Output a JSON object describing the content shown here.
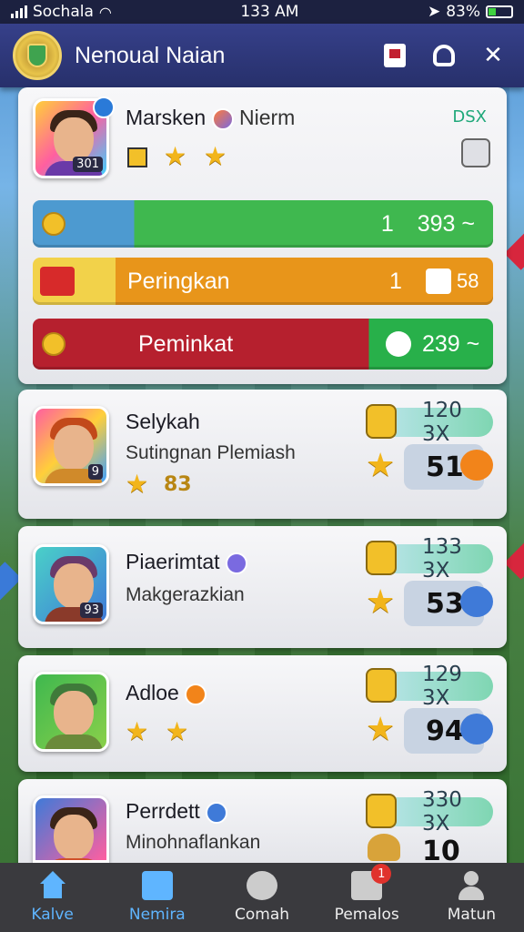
{
  "status_bar": {
    "carrier": "Sochala",
    "time": "133 AM",
    "battery": "83%"
  },
  "header": {
    "title": "Nenoual Naian"
  },
  "top_card": {
    "player_name": "Marsken",
    "player_suffix": "Nierm",
    "avatar_tag": "301",
    "right_label": "DSX",
    "bar_green_value": "393 ~",
    "bar_green_prefix": "1",
    "bar_orange_label": "Peringkan",
    "bar_orange_value": "1",
    "bar_orange_right": "58",
    "bar_red_label": "Peminkat",
    "bar_red_value": "239 ~"
  },
  "players": [
    {
      "name": "Selykah",
      "subtitle": "Sutingnan Plemiash",
      "avatar_tag": "9",
      "extra": "83",
      "pill": "120 3X",
      "score": "51"
    },
    {
      "name": "Piaerimtat",
      "subtitle": "Makgerazkian",
      "avatar_tag": "93",
      "extra": "",
      "pill": "133 3X",
      "score": "53"
    },
    {
      "name": "Adloe",
      "subtitle": "",
      "avatar_tag": "",
      "extra": "",
      "pill": "129 3X",
      "score": "94"
    },
    {
      "name": "Perrdett",
      "subtitle": "Minohnaflankan",
      "avatar_tag": "",
      "extra": "",
      "pill": "330 3X",
      "score": "10"
    }
  ],
  "nav": {
    "items": [
      {
        "label": "Kalve"
      },
      {
        "label": "Nemira"
      },
      {
        "label": "Comah"
      },
      {
        "label": "Pemalos",
        "badge": "1"
      },
      {
        "label": "Matun"
      }
    ]
  },
  "colors": {
    "accent": "#5fb5ff",
    "header": "#27306b",
    "green": "#3fb84f",
    "orange": "#e8951a",
    "red": "#b6202e"
  }
}
